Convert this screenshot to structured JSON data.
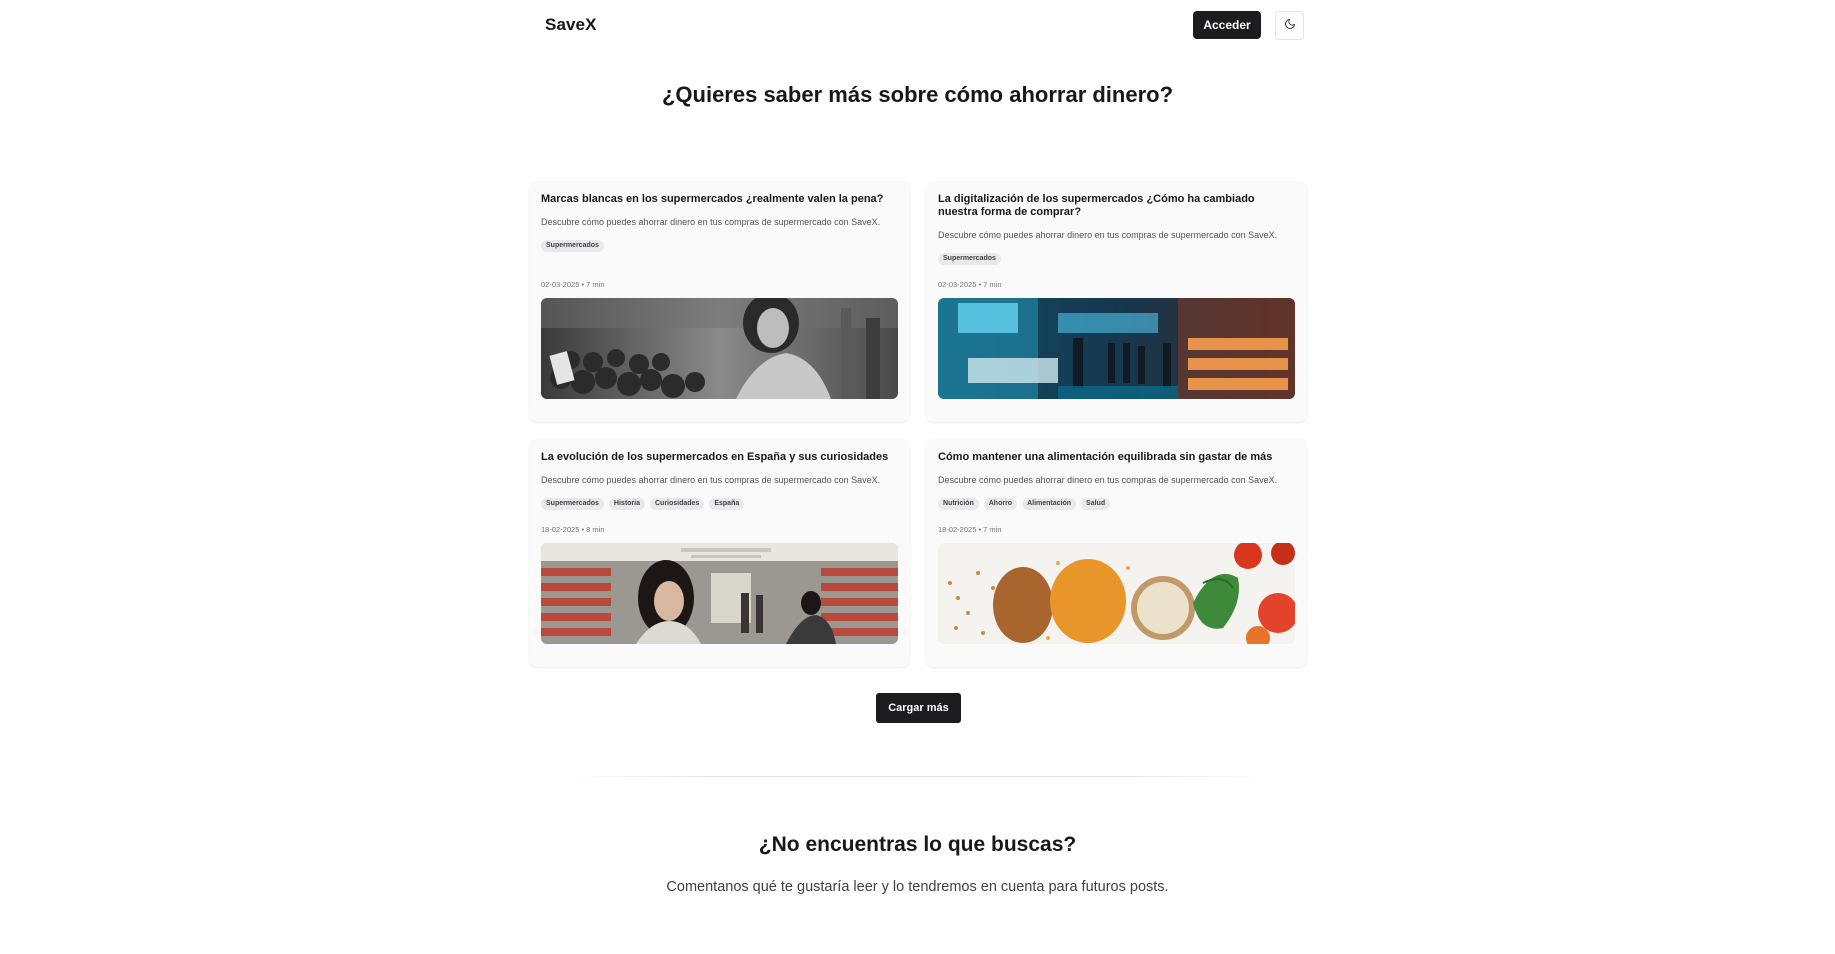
{
  "header": {
    "brand": "SaveX",
    "login_label": "Acceder",
    "theme_icon": "moon-icon"
  },
  "main": {
    "title": "¿Quieres saber más sobre cómo ahorrar dinero?",
    "posts": [
      {
        "title": "Marcas blancas en los supermercados ¿realmente valen la pena?",
        "description": "Descubre cómo puedes ahorrar dinero en tus compras de supermercado con SaveX.",
        "tags": [
          "Supermercados"
        ],
        "meta": "02-03-2025 • 7 min"
      },
      {
        "title": "La digitalización de los supermercados ¿Cómo ha cambiado nuestra forma de comprar?",
        "description": "Descubre cómo puedes ahorrar dinero en tus compras de supermercado con SaveX.",
        "tags": [
          "Supermercados"
        ],
        "meta": "02-03-2025 • 7 min"
      },
      {
        "title": "La evolución de los supermercados en España y sus curiosidades",
        "description": "Descubre cómo puedes ahorrar dinero en tus compras de supermercado con SaveX.",
        "tags": [
          "Supermercados",
          "Historia",
          "Curiosidades",
          "España"
        ],
        "meta": "18-02-2025 • 8 min"
      },
      {
        "title": "Cómo mantener una alimentación equilibrada sin gastar de más",
        "description": "Descubre cómo puedes ahorrar dinero en tus compras de supermercado con SaveX.",
        "tags": [
          "Nutrición",
          "Ahorro",
          "Alimentación",
          "Salud"
        ],
        "meta": "18-02-2025 • 7 min"
      }
    ],
    "load_more_label": "Cargar más"
  },
  "footer": {
    "title": "¿No encuentras lo que buscas?",
    "text": "Comentanos qué te gustaría leer y lo tendremos en cuenta para futuros posts."
  }
}
